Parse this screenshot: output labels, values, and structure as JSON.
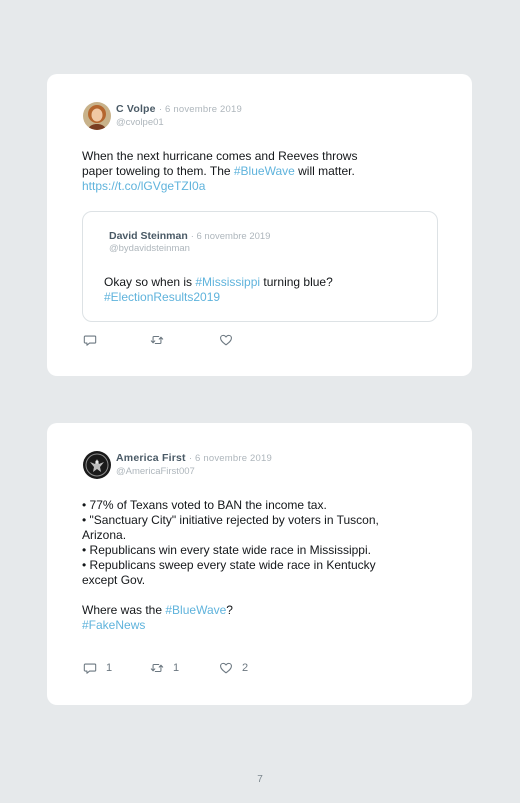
{
  "tweets": [
    {
      "author": "C Volpe",
      "date": "· 6 novembre 2019",
      "handle": "@cvolpe01",
      "avatar": "profile-photo",
      "text_lines": [
        [
          {
            "t": "When the next hurricane comes and Reeves throws"
          }
        ],
        [
          {
            "t": "paper toweling to them. The "
          },
          {
            "t": "#BlueWave",
            "link": true
          },
          {
            "t": " will matter."
          }
        ],
        [
          {
            "t": "https://t.co/lGVgeTZI0a",
            "link": true
          }
        ]
      ],
      "quote": {
        "author": "David Steinman",
        "date": "· 6 novembre 2019",
        "handle": "@bydavidsteinman",
        "text_lines": [
          [
            {
              "t": "Okay so when is "
            },
            {
              "t": "#Mississippi",
              "link": true
            },
            {
              "t": " turning blue?"
            }
          ],
          [
            {
              "t": "#ElectionResults2019",
              "link": true
            }
          ]
        ]
      },
      "actions": {
        "reply": {
          "icon": "reply-icon",
          "count": ""
        },
        "retweet": {
          "icon": "retweet-icon",
          "count": ""
        },
        "like": {
          "icon": "heart-icon",
          "count": ""
        }
      }
    },
    {
      "author": "America First",
      "date": "· 6 novembre 2019",
      "handle": "@AmericaFirst007",
      "avatar": "eagle-logo",
      "text_lines": [
        [
          {
            "t": "• 77% of Texans voted to BAN the income tax."
          }
        ],
        [
          {
            "t": "• \"Sanctuary City\" initiative rejected by voters in Tuscon,"
          }
        ],
        [
          {
            "t": "Arizona."
          }
        ],
        [
          {
            "t": "• Republicans win every state wide race in Mississippi."
          }
        ],
        [
          {
            "t": "• Republicans sweep every state wide race in Kentucky"
          }
        ],
        [
          {
            "t": "except Gov."
          }
        ],
        [
          {
            "t": " "
          }
        ],
        [
          {
            "t": "Where was the "
          },
          {
            "t": "#BlueWave",
            "link": true
          },
          {
            "t": "?"
          }
        ],
        [
          {
            "t": "#FakeNews",
            "link": true
          }
        ]
      ],
      "actions": {
        "reply": {
          "icon": "reply-icon",
          "count": "1"
        },
        "retweet": {
          "icon": "retweet-icon",
          "count": "1"
        },
        "like": {
          "icon": "heart-icon",
          "count": "2"
        }
      }
    }
  ],
  "page_number": "7",
  "colors": {
    "background": "#e6e9eb",
    "card": "#ffffff",
    "link": "#5fb3dc",
    "meta": "#aeb6bc",
    "name": "#4a5a66",
    "text": "#14171a"
  }
}
